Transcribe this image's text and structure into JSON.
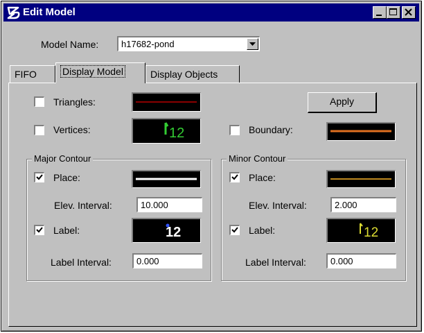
{
  "window": {
    "title": "Edit Model"
  },
  "model": {
    "label": "Model Name:",
    "value": "h17682-pond"
  },
  "tabs": [
    {
      "label": "FIFO"
    },
    {
      "label": "Display Model"
    },
    {
      "label": "Display Objects"
    }
  ],
  "display": {
    "triangles": {
      "label": "Triangles:",
      "checked": false,
      "color": "#8b0000"
    },
    "vertices": {
      "label": "Vertices:",
      "checked": false,
      "sample": "12",
      "color": "#33cc33"
    },
    "boundary": {
      "label": "Boundary:",
      "checked": false,
      "color": "#e07020"
    },
    "apply_label": "Apply"
  },
  "major": {
    "title": "Major Contour",
    "place_label": "Place:",
    "place_checked": true,
    "place_color": "#ffffff",
    "elev_label": "Elev. Interval:",
    "elev_value": "10.000",
    "label_label": "Label:",
    "label_checked": true,
    "label_sample": "12",
    "label_color": "#ffffff",
    "label_interval_label": "Label Interval:",
    "label_interval_value": "0.000"
  },
  "minor": {
    "title": "Minor Contour",
    "place_label": "Place:",
    "place_checked": true,
    "place_color": "#c08a20",
    "elev_label": "Elev. Interval:",
    "elev_value": "2.000",
    "label_label": "Label:",
    "label_checked": true,
    "label_sample": "12",
    "label_color": "#dddd33",
    "label_interval_label": "Label Interval:",
    "label_interval_value": "0.000"
  }
}
